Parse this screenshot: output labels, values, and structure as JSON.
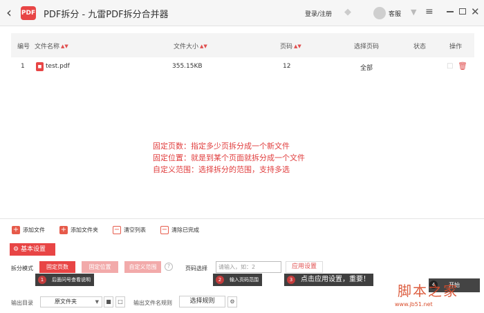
{
  "titlebar": {
    "app_title": "PDF拆分 - 九雷PDF拆分合并器",
    "logo_text": "PDF",
    "login_label": "登录/注册",
    "service_label": "客服",
    "icons": [
      "back-icon",
      "diamond-icon",
      "shirt-icon",
      "menu-icon",
      "minimize-icon",
      "maximize-icon",
      "close-icon"
    ]
  },
  "table": {
    "headers": [
      "编号",
      "文件名称",
      "文件大小",
      "页码",
      "选择页码",
      "状态",
      "操作"
    ],
    "rows": [
      {
        "index": "1",
        "name": "test.pdf",
        "size": "355.15KB",
        "pages": "12",
        "selected": "全部",
        "status": ""
      }
    ]
  },
  "note": {
    "lines": [
      "固定页数：指定多少页拆分成一个新文件",
      "固定位置：就是到某个页面就拆分成一个文件",
      "自定义范围：选择拆分的范围，支持多选"
    ]
  },
  "toolbar": {
    "add_file": "添加文件",
    "add_folder": "添加文件夹",
    "clear_list": "清空列表",
    "clear_done": "清除已完成"
  },
  "settings": {
    "basic_label": "基本设置",
    "split_mode_label": "拆分模式",
    "modes": [
      "固定页数",
      "固定位置",
      "自定义范围"
    ],
    "page_select_label": "页码选择",
    "page_input_placeholder": "请输入，如：2",
    "apply_label": "应用设置"
  },
  "hints": [
    {
      "num": "1",
      "text": "后面问号查看说明"
    },
    {
      "num": "2",
      "text": "输入页码范围"
    },
    {
      "num": "3",
      "text": "点击应用设置，重要！"
    },
    {
      "num": "4",
      "text": "开始"
    }
  ],
  "output": {
    "dir_label": "输出目录",
    "dir_value": "原文件夹",
    "rule_label": "输出文件名规则",
    "rule_button": "选择规则"
  },
  "watermark": {
    "text": "脚本之家",
    "url": "www.jb51.net"
  },
  "colors": {
    "accent": "#e84545",
    "note_text": "#e03c3c",
    "hint_bg": "#3f3f3f"
  }
}
